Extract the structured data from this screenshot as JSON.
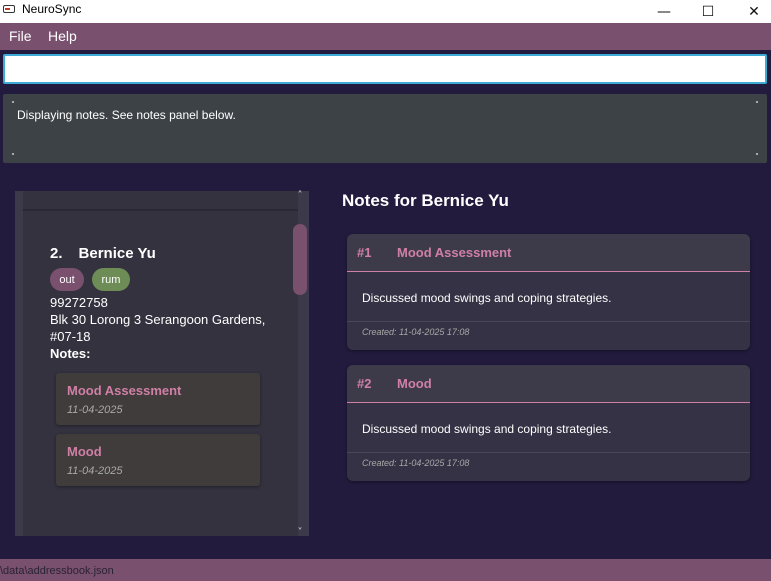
{
  "window": {
    "title": "NeuroSync",
    "minimize": "—",
    "maximize": "☐",
    "close": "✕"
  },
  "menu": {
    "file": "File",
    "help": "Help"
  },
  "command": {
    "value": ""
  },
  "result": {
    "text": "Displaying notes. See notes panel below."
  },
  "person": {
    "index": "2.",
    "name": "Bernice Yu",
    "tags": [
      "out",
      "rum"
    ],
    "phone": "99272758",
    "address_line1": "Blk 30 Lorong 3 Serangoon Gardens,",
    "address_line2": "#07-18",
    "notes_label": "Notes:",
    "notes": [
      {
        "title": "Mood Assessment",
        "date": "11-04-2025"
      },
      {
        "title": "Mood",
        "date": "11-04-2025"
      }
    ]
  },
  "notes_panel": {
    "title": "Notes for Bernice Yu",
    "notes": [
      {
        "number": "#1",
        "title": "Mood Assessment",
        "body": "Discussed mood swings and coping strategies.",
        "created": "Created: 11-04-2025 17:08"
      },
      {
        "number": "#2",
        "title": "Mood",
        "body": "Discussed mood swings and coping strategies.",
        "created": "Created: 11-04-2025 17:08"
      }
    ]
  },
  "status": {
    "path": "\\data\\addressbook.json"
  },
  "colors": {
    "accent": "#79506e",
    "note_title": "#d07fa6",
    "tag_out": "#79506e",
    "tag_rum": "#6e8c56",
    "command_border": "#3dabd6"
  }
}
